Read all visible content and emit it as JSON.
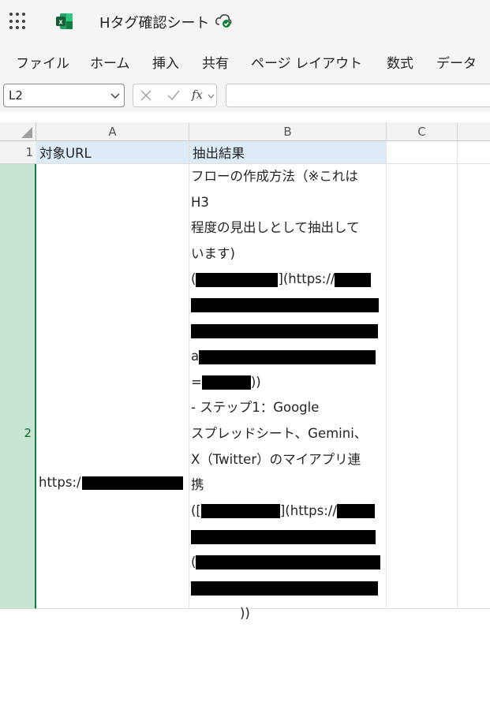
{
  "app": {
    "title": "Hタグ確認シート",
    "icons": {
      "launcher": "waffle-icon",
      "app": "excel-icon",
      "sync": "cloud-saved-icon"
    }
  },
  "menu": {
    "items": [
      "ファイル",
      "ホーム",
      "挿入",
      "共有",
      "ページ レイアウト",
      "数式",
      "データ"
    ]
  },
  "formula_bar": {
    "name_box": "L2",
    "fx_label": "fx",
    "formula": ""
  },
  "sheet": {
    "columns": [
      "A",
      "B",
      "C"
    ],
    "rows": [
      "1",
      "2"
    ],
    "cells": {
      "A1": "対象URL",
      "B1": "抽出結果",
      "A2": "https:/",
      "B2_lines": [
        "フローの作成方法（※これは",
        "H3",
        "程度の見出しとして抽出して",
        "います)",
        "(",
        "",
        "",
        "a",
        "=",
        "- ステップ1：Google",
        "スプレッドシート、Gemini、",
        "X（Twitter）のマイアプリ連",
        "携",
        "([",
        "",
        "(",
        "",
        "))"
      ],
      "B2_fragments": {
        "link1_tail": "](https://",
        "link1_close": "))",
        "link2_tail": "](https://",
        "link2_close": "))"
      }
    },
    "accent_color": "#107c41",
    "header_fill": "#ddebf7"
  }
}
